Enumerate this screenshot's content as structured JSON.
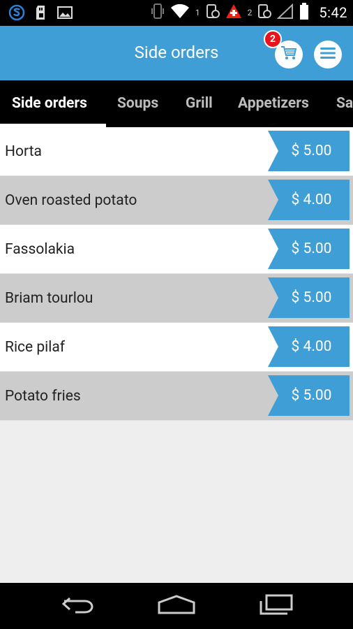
{
  "status_bar": {
    "time": "5:42",
    "sim1_label": "1",
    "sim2_label": "2",
    "icons": [
      "app-s-icon",
      "sd-card-icon",
      "image-icon",
      "vibrate-icon",
      "wifi-icon",
      "signal-icon",
      "battery-icon"
    ]
  },
  "app_bar": {
    "title": "Side orders",
    "cart_count": "2",
    "accent_color": "#3f9ed5",
    "badge_color": "#e8131b"
  },
  "tabs": [
    {
      "label": "Side orders",
      "active": true
    },
    {
      "label": "Soups",
      "active": false
    },
    {
      "label": "Grill",
      "active": false
    },
    {
      "label": "Appetizers",
      "active": false
    },
    {
      "label": "Sa",
      "active": false
    }
  ],
  "menu_items": [
    {
      "name": "Horta",
      "price": "$ 5.00"
    },
    {
      "name": "Oven roasted potato",
      "price": "$ 4.00"
    },
    {
      "name": "Fassolakia",
      "price": "$ 5.00"
    },
    {
      "name": "Briam tourlou",
      "price": "$ 5.00"
    },
    {
      "name": "Rice pilaf",
      "price": "$ 4.00"
    },
    {
      "name": "Potato fries",
      "price": "$ 5.00"
    }
  ],
  "nav_bar": {
    "buttons": [
      "back-icon",
      "home-icon",
      "recent-apps-icon"
    ]
  }
}
